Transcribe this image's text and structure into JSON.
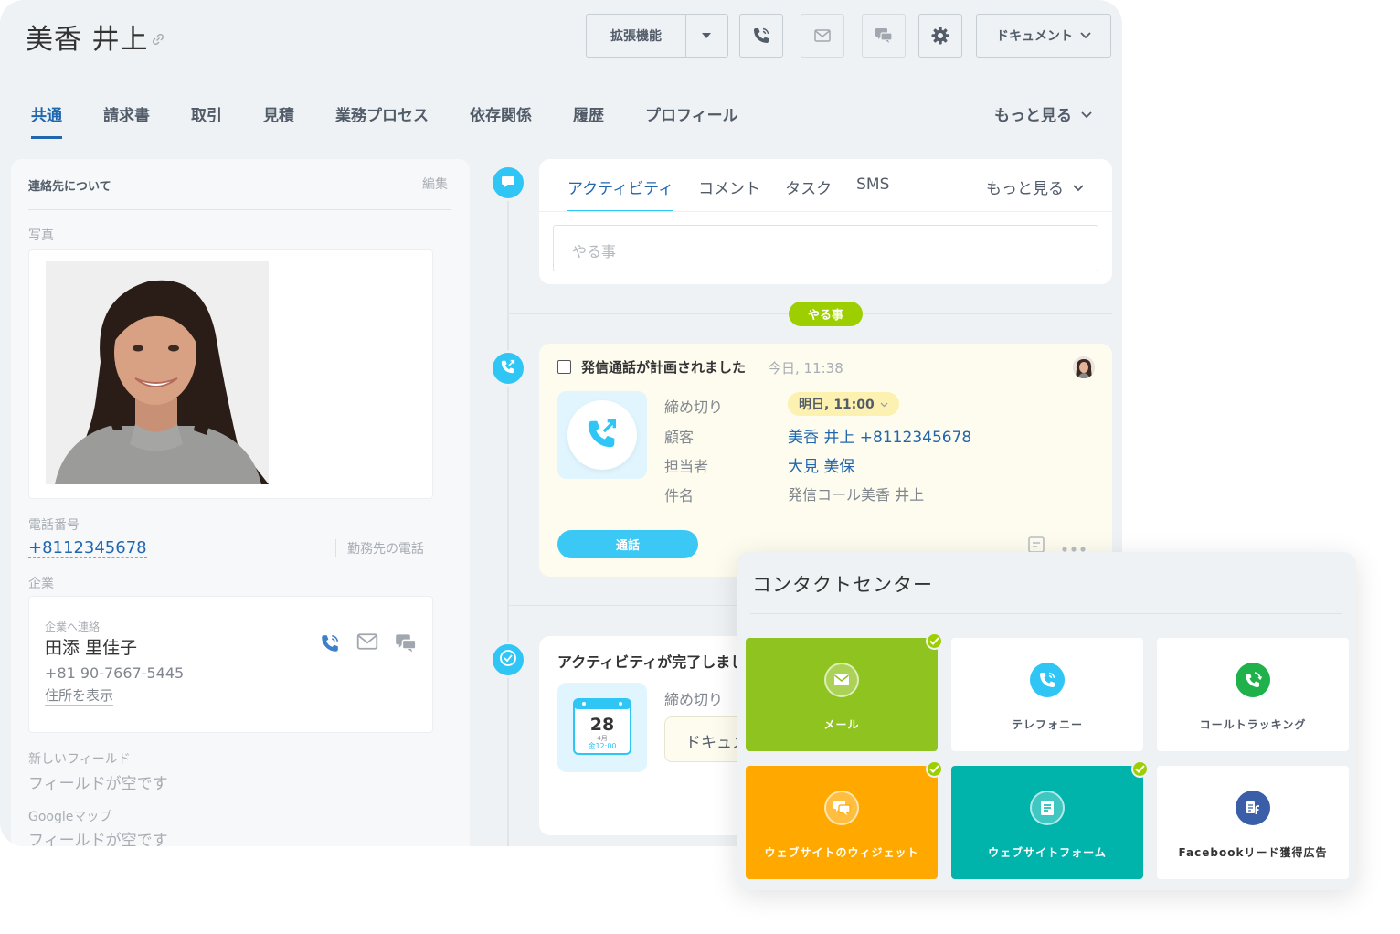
{
  "header": {
    "title": "美香 井上",
    "extensions_label": "拡張機能",
    "document_label": "ドキュメント"
  },
  "tabs": [
    "共通",
    "請求書",
    "取引",
    "見積",
    "業務プロセス",
    "依存関係",
    "履歴",
    "プロフィール"
  ],
  "tabs_more": "もっと見る",
  "about": {
    "heading": "連絡先について",
    "edit": "編集",
    "photo_label": "写真",
    "phone_label": "電話番号",
    "phone": "+8112345678",
    "work_phone": "勤務先の電話",
    "company_label": "企業",
    "company_contact_label": "企業へ連絡",
    "company_contact_name": "田添 里佳子",
    "company_contact_phone": "+81 90-7667-5445",
    "show_address": "住所を表示",
    "new_field_label": "新しいフィールド",
    "new_field_value": "フィールドが空です",
    "map_label": "Googleマップ",
    "map_value": "フィールドが空です"
  },
  "editor": {
    "tabs": [
      "アクティビティ",
      "コメント",
      "タスク",
      "SMS"
    ],
    "more": "もっと見る",
    "placeholder": "やる事"
  },
  "todo_badge": "やる事",
  "activity": {
    "title": "発信通話が計画されました",
    "time": "今日, 11:38",
    "fields": [
      {
        "label": "締め切り",
        "value": "明日, 11:00"
      },
      {
        "label": "顧客",
        "value": "美香 井上 +8112345678"
      },
      {
        "label": "担当者",
        "value": "大見 美保"
      },
      {
        "label": "件名",
        "value": "発信コール美香 井上"
      }
    ],
    "call_button": "通話"
  },
  "done": {
    "title": "アクティビティが完了しました",
    "deadline_label": "締め切り",
    "document": "ドキュメント",
    "calendar_day": "28",
    "calendar_month": "4月",
    "calendar_time": "金12:00"
  },
  "contact_center": {
    "title": "コンタクトセンター",
    "tiles": [
      {
        "label": "メール",
        "bg": "#8fc31f",
        "icon": "mail-icon",
        "checked": true
      },
      {
        "label": "テレフォニー",
        "bg": "#ffffff",
        "icon": "phone-icon",
        "checked": false
      },
      {
        "label": "コールトラッキング",
        "bg": "#ffffff",
        "icon": "call-tracking-icon",
        "checked": false
      },
      {
        "label": "ウェブサイトのウィジェット",
        "bg": "#ffa900",
        "icon": "chat-icon",
        "checked": true
      },
      {
        "label": "ウェブサイトフォーム",
        "bg": "#00b4ac",
        "icon": "form-icon",
        "checked": true
      },
      {
        "label": "Facebookリード獲得広告",
        "bg": "#ffffff",
        "icon": "facebook-leads-icon",
        "checked": false
      }
    ]
  },
  "colors": {
    "accent_blue": "#2067b0",
    "timeline_blue": "#2fc6f6",
    "todo_green": "#9dcf00",
    "activity_bg": "#fefcee"
  }
}
